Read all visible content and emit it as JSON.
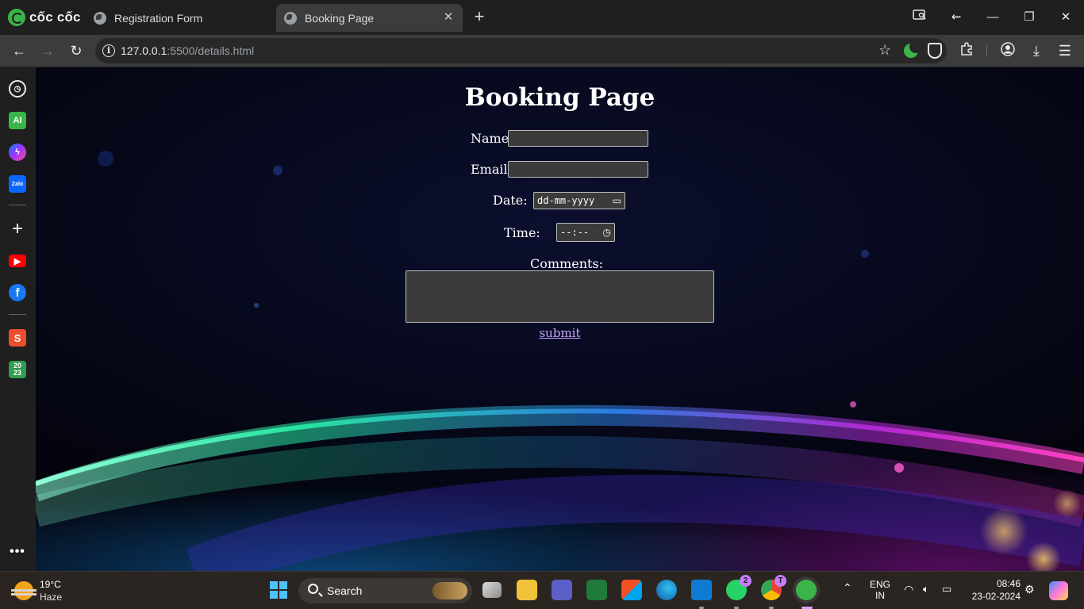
{
  "browser": {
    "brand": "cốc cốc",
    "tabs": [
      {
        "label": "Registration Form",
        "active": false
      },
      {
        "label": "Booking Page",
        "active": true
      }
    ],
    "url_host": "127.0.0.1",
    "url_rest": ":5500/details.html"
  },
  "page": {
    "title": "Booking Page",
    "labels": {
      "name": "Name:",
      "email": "Email:",
      "date": "Date:",
      "time": "Time:",
      "comments": "Comments:"
    },
    "date_placeholder": "dd-mm-yyyy",
    "time_placeholder": "--:--",
    "submit_label": "submit"
  },
  "sidebar": {
    "items": [
      "history-icon",
      "ai-icon",
      "messenger-icon",
      "zalo-icon",
      "add-icon",
      "youtube-icon",
      "facebook-icon",
      "shopee-icon",
      "calendar-2023-icon",
      "more-icon"
    ]
  },
  "taskbar": {
    "weather_temp": "19°C",
    "weather_desc": "Haze",
    "search_label": "Search",
    "whatsapp_badge": "2",
    "chrome_badge": "T",
    "lang_top": "ENG",
    "lang_bottom": "IN",
    "time": "08:46",
    "date": "23-02-2024"
  },
  "colors": {
    "browser_bg": "#1f1f1f",
    "toolbar_bg": "#3c3c3c",
    "link": "#c7a6ff",
    "coccoc_green": "#3ab54a",
    "taskbar_bg": "#2a2521"
  }
}
